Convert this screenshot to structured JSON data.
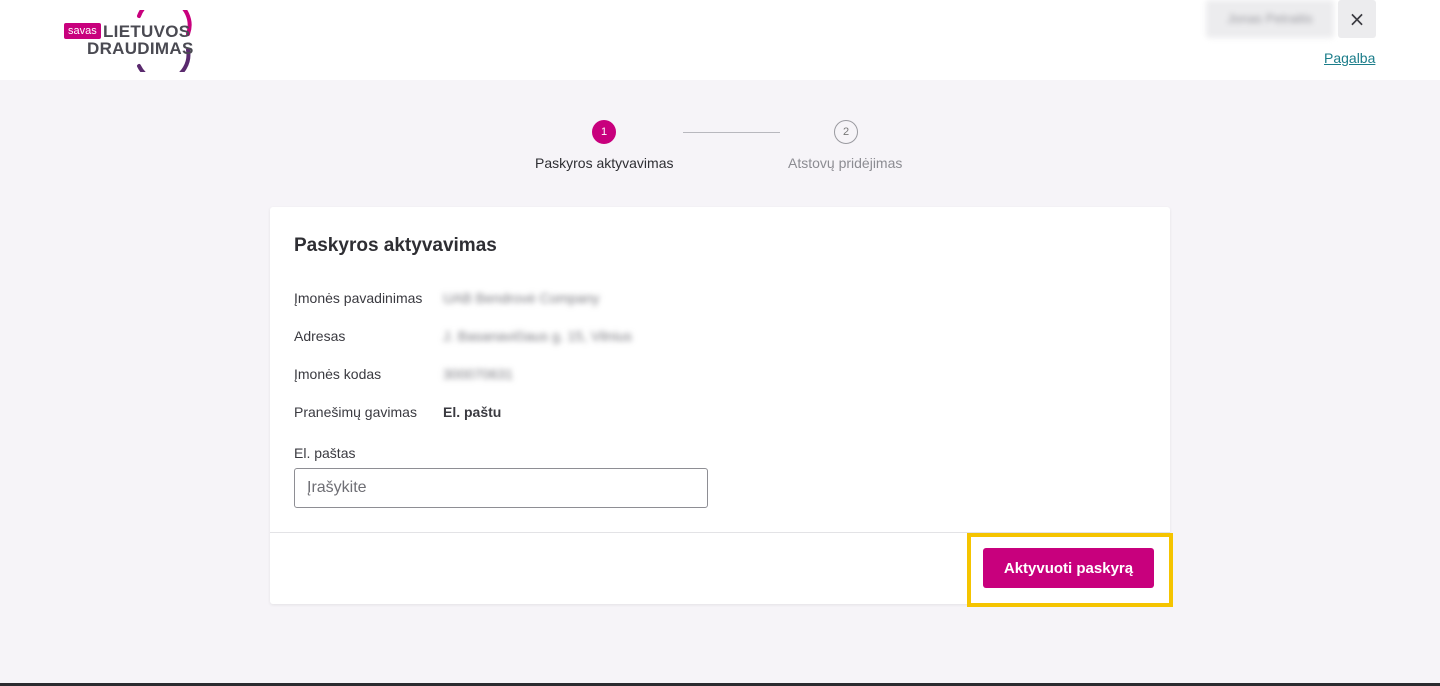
{
  "header": {
    "logo": {
      "badge": "savas",
      "line1": "LIETUVOS",
      "line2": "DRAUDIMAS"
    },
    "user_name": "Jonas Petraitis",
    "close_label": "×",
    "help_link": "Pagalba"
  },
  "stepper": {
    "steps": [
      {
        "number": "1",
        "label": "Paskyros aktyvavimas"
      },
      {
        "number": "2",
        "label": "Atstovų pridėjimas"
      }
    ]
  },
  "card": {
    "title": "Paskyros aktyvavimas",
    "rows": [
      {
        "label": "Įmonės pavadinimas",
        "value": "UAB Bendrovė Company"
      },
      {
        "label": "Adresas",
        "value": "J. Basanavičiaus g. 15, Vilnius"
      },
      {
        "label": "Įmonės kodas",
        "value": "300070631"
      },
      {
        "label": "Pranešimų gavimas",
        "value": "El. paštu"
      }
    ],
    "email": {
      "label": "El. paštas",
      "placeholder": "Įrašykite",
      "value": ""
    },
    "submit_label": "Aktyvuoti paskyrą"
  },
  "colors": {
    "brand": "#c8007d",
    "highlight": "#f5c400",
    "link": "#1b7d8a"
  }
}
